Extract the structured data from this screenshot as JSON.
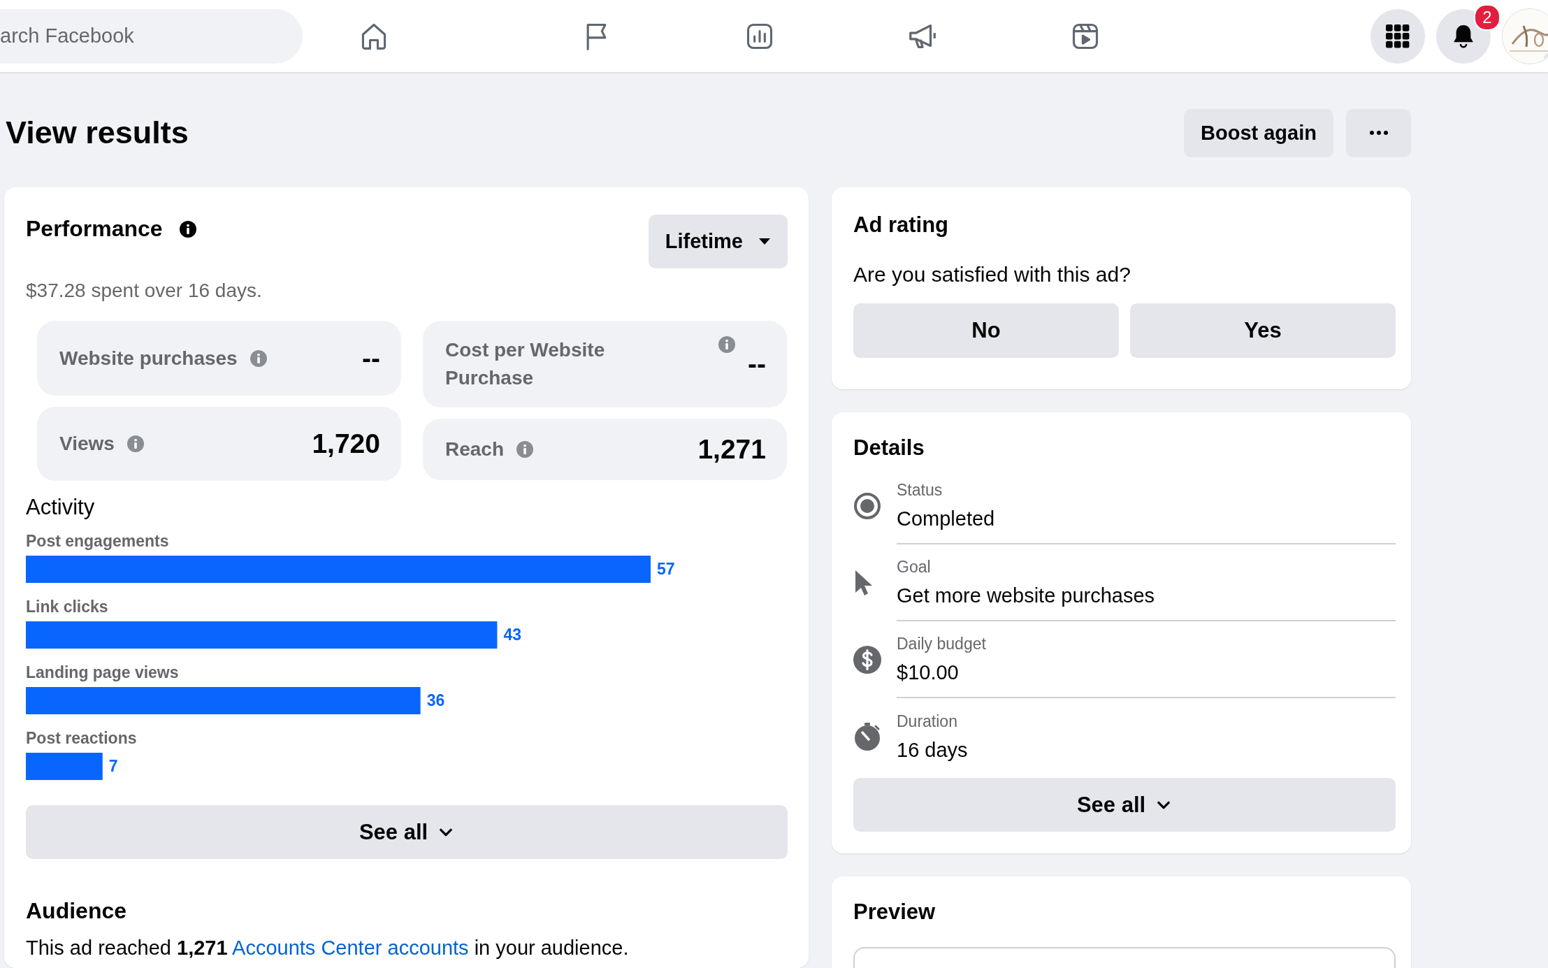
{
  "topbar": {
    "search": {
      "placeholder": "arch Facebook"
    },
    "nav": [
      {
        "kind": "home"
      },
      {
        "kind": "flag"
      },
      {
        "kind": "insights"
      },
      {
        "kind": "megaphone"
      },
      {
        "kind": "reels"
      }
    ],
    "notifications": {
      "badge": "2"
    }
  },
  "page": {
    "title": "View results",
    "boost_button": "Boost again"
  },
  "performance": {
    "title": "Performance",
    "period": "Lifetime",
    "spent": "$37.28 spent over 16 days.",
    "metrics": [
      [
        {
          "label": "Website purchases",
          "value": "--"
        },
        {
          "label": "Views",
          "value": "1,720"
        }
      ],
      [
        {
          "label": "Cost per Website Purchase",
          "value": "--"
        },
        {
          "label": "Reach",
          "value": "1,271"
        }
      ]
    ],
    "activity": {
      "title": "Activity",
      "chart_data": {
        "type": "bar",
        "orientation": "horizontal",
        "categories": [
          "Post engagements",
          "Link clicks",
          "Landing page views",
          "Post reactions"
        ],
        "values": [
          57,
          43,
          36,
          7
        ],
        "data_labels": true
      }
    },
    "see_all": "See all",
    "audience": {
      "title": "Audience",
      "text_before": "This ad reached **1,271** ",
      "link": "Accounts Center accounts",
      "text_after": " in your audience."
    }
  },
  "ad_rating": {
    "title": "Ad rating",
    "question": "Are you satisfied with this ad?",
    "buttons": [
      "No",
      "Yes"
    ]
  },
  "details": {
    "title": "Details",
    "rows": [
      {
        "kind": "status",
        "label": "Status",
        "value": "Completed"
      },
      {
        "kind": "goal",
        "label": "Goal",
        "value": "Get more website purchases"
      },
      {
        "kind": "budget",
        "label": "Daily budget",
        "value": "$10.00"
      },
      {
        "kind": "duration",
        "label": "Duration",
        "value": "16 days"
      }
    ],
    "see_all": "See all"
  },
  "preview": {
    "title": "Preview"
  }
}
